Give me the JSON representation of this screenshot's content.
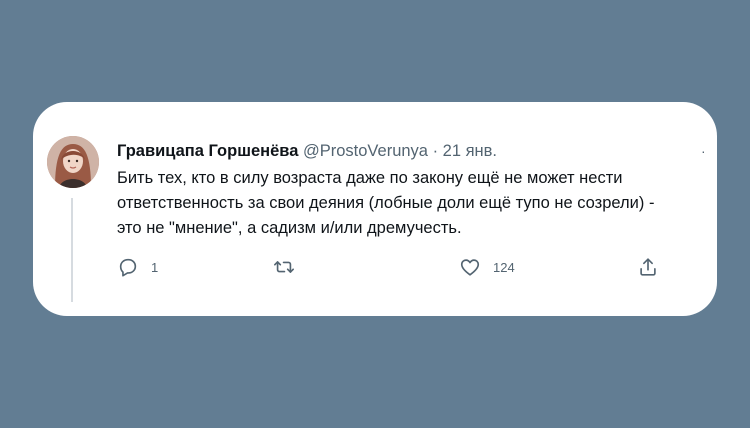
{
  "tweet": {
    "author_name": "Гравицапа Горшенёва",
    "handle": "@ProstoVerunya",
    "separator": "·",
    "date": "21 янв.",
    "text_lines": [
      "Бить тех, кто в силу возраста даже по закону ещё не может нести",
      "ответственность за свои деяния (лобные доли ещё тупо не созрели) -",
      "это не \"мнение\", а садизм и/или дремучесть."
    ],
    "more_icon": "more-dots-icon",
    "avatar": "author-avatar"
  },
  "actions": {
    "reply": {
      "icon": "reply-icon",
      "count": "1"
    },
    "retweet": {
      "icon": "retweet-icon",
      "count": ""
    },
    "like": {
      "icon": "heart-icon",
      "count": "124"
    },
    "share": {
      "icon": "share-icon",
      "count": ""
    }
  },
  "colors": {
    "background": "#627d93",
    "card": "#ffffff",
    "primary_text": "#0f1419",
    "secondary_text": "#536471"
  }
}
